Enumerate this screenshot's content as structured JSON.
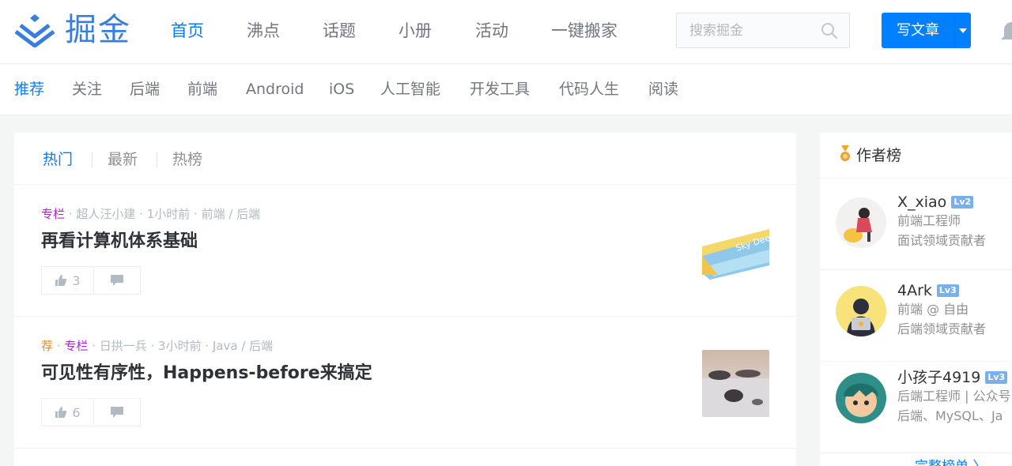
{
  "header": {
    "logo_text": "掘金",
    "nav": [
      "首页",
      "沸点",
      "话题",
      "小册",
      "活动",
      "一键搬家"
    ],
    "active_nav": 0,
    "search_placeholder": "搜索掘金",
    "write_label": "写文章"
  },
  "tags": [
    "推荐",
    "关注",
    "后端",
    "前端",
    "Android",
    "iOS",
    "人工智能",
    "开发工具",
    "代码人生",
    "阅读"
  ],
  "feed": {
    "tabs": [
      "热门",
      "最新",
      "热榜"
    ],
    "entries": [
      {
        "badge_rec": "",
        "badge_col": "专栏",
        "author": "超人汪小建",
        "time": "1小时前",
        "categories": "前端 / 后端",
        "title": "再看计算机体系基础",
        "likes": "3"
      },
      {
        "badge_rec": "荐",
        "badge_col": "专栏",
        "author": "日拱一兵",
        "time": "3小时前",
        "categories": "Java / 后端",
        "title": "可见性有序性，Happens-before来搞定",
        "likes": "6"
      }
    ]
  },
  "sidebar": {
    "title": "作者榜",
    "authors": [
      {
        "name": "X_xiao",
        "level": "Lv2",
        "line1": "前端工程师",
        "line2": "面试领域贡献者"
      },
      {
        "name": "4Ark",
        "level": "Lv3",
        "line1": "前端 @ 自由",
        "line2": "后端领域贡献者"
      },
      {
        "name": "小孩子4919",
        "level": "Lv3",
        "line1": "后端工程师 | 公众号",
        "line2": "后端、MySQL、Ja"
      }
    ],
    "full_list": "完整榜单 〉"
  },
  "colors": {
    "brand": "#007fff",
    "logo": "#3a7edd",
    "column_badge": "#b71ed7",
    "recommend_badge": "#f0861b"
  }
}
